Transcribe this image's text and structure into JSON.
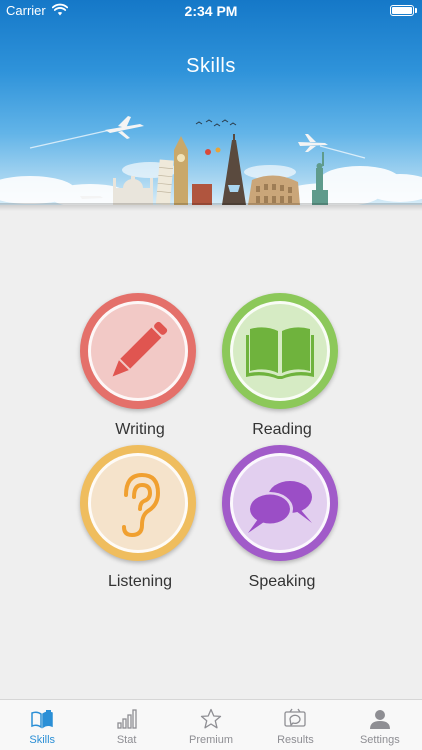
{
  "status_bar": {
    "carrier": "Carrier",
    "time": "2:34 PM"
  },
  "header": {
    "title": "Skills"
  },
  "skills": [
    {
      "label": "Writing",
      "icon": "pencil-icon",
      "ring_color": "#e4706a",
      "inner_color": "#f2c9c6",
      "icon_color": "#e05550"
    },
    {
      "label": "Reading",
      "icon": "book-icon",
      "ring_color": "#8cc85a",
      "inner_color": "#d6ebc4",
      "icon_color": "#6fb33d"
    },
    {
      "label": "Listening",
      "icon": "ear-icon",
      "ring_color": "#efbd5e",
      "inner_color": "#f5e3cb",
      "icon_color": "#f0a030"
    },
    {
      "label": "Speaking",
      "icon": "speech-bubbles-icon",
      "ring_color": "#a15bc9",
      "inner_color": "#e2cfef",
      "icon_color": "#9b4ec6"
    }
  ],
  "tabbar": {
    "tabs": [
      {
        "label": "Skills",
        "icon": "book-icon",
        "active": true
      },
      {
        "label": "Stat",
        "icon": "bar-chart-icon",
        "active": false
      },
      {
        "label": "Premium",
        "icon": "star-icon",
        "active": false
      },
      {
        "label": "Results",
        "icon": "results-icon",
        "active": false
      },
      {
        "label": "Settings",
        "icon": "user-icon",
        "active": false
      }
    ],
    "active_color": "#2b8fd6",
    "inactive_color": "#8e8e93"
  }
}
